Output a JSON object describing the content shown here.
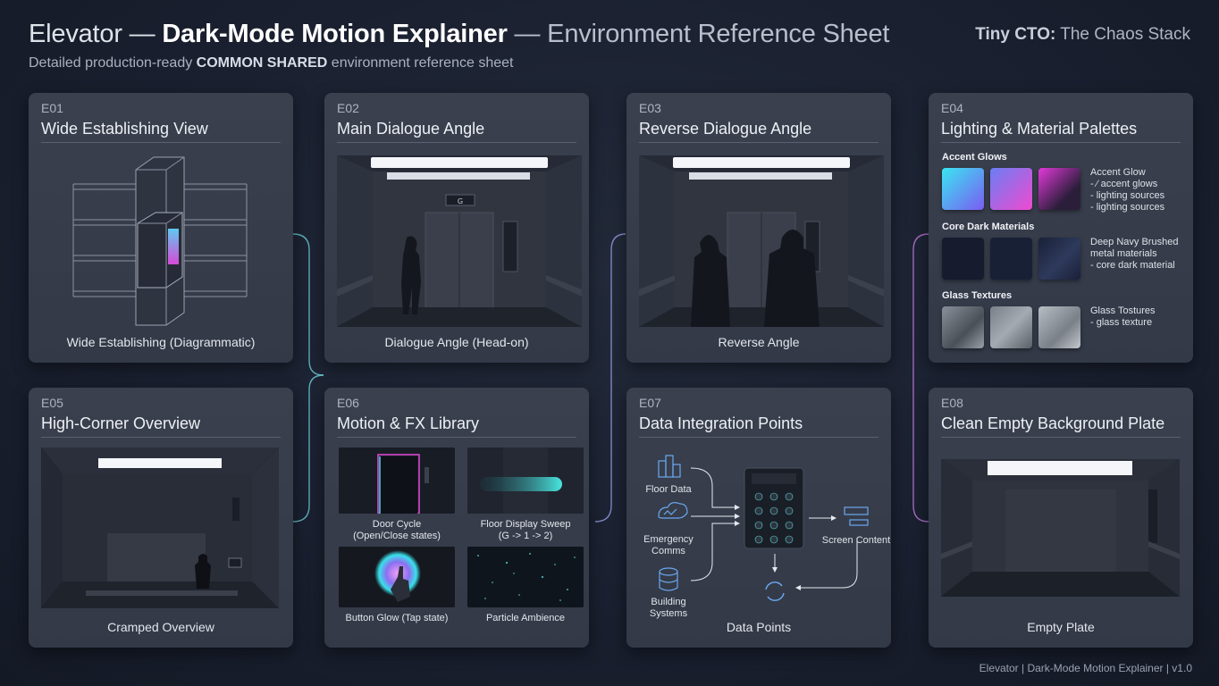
{
  "header": {
    "title_prefix": "Elevator — ",
    "title_bold": "Dark-Mode Motion Explainer",
    "title_suffix": " — Environment Reference Sheet",
    "subtitle_prefix": "Detailed production-ready ",
    "subtitle_bold": "COMMON SHARED",
    "subtitle_suffix": " environment reference sheet",
    "brand_bold": "Tiny CTO:",
    "brand_rest": " The Chaos Stack"
  },
  "footer": "Elevator | Dark-Mode Motion Explainer | v1.0",
  "panels": {
    "e01": {
      "code": "E01",
      "title": "Wide Establishing View",
      "caption": "Wide Establishing (Diagrammatic)"
    },
    "e02": {
      "code": "E02",
      "title": "Main Dialogue Angle",
      "caption": "Dialogue Angle (Head-on)",
      "floor": "G"
    },
    "e03": {
      "code": "E03",
      "title": "Reverse Dialogue Angle",
      "caption": "Reverse Angle"
    },
    "e04": {
      "code": "E04",
      "title": "Lighting & Material Palettes",
      "accent": {
        "label": "Accent Glows",
        "desc": [
          "Accent Glow",
          "- ⁄ accent glows",
          "- lighting sources",
          "- lighting sources"
        ]
      },
      "core": {
        "label": "Core Dark Materials",
        "desc": [
          "Deep Navy Brushed",
          "metal materials",
          "- core dark material"
        ]
      },
      "glass": {
        "label": "Glass Textures",
        "desc": [
          "Glass Tostures",
          "- glass texture"
        ]
      }
    },
    "e05": {
      "code": "E05",
      "title": "High-Corner Overview",
      "caption": "Cramped Overview"
    },
    "e06": {
      "code": "E06",
      "title": "Motion & FX Library",
      "items": [
        {
          "caption_1": "Door Cycle",
          "caption_2": "(Open/Close states)"
        },
        {
          "caption_1": "Floor Display Sweep",
          "caption_2": "(G -> 1 -> 2)"
        },
        {
          "caption_1": "Button Glow (Tap state)",
          "caption_2": ""
        },
        {
          "caption_1": "Particle Ambience",
          "caption_2": ""
        }
      ]
    },
    "e07": {
      "code": "E07",
      "title": "Data Integration Points",
      "caption": "Data Points",
      "floor_data": "Floor Data",
      "emergency_1": "Emergency",
      "emergency_2": "Comms",
      "building_1": "Building",
      "building_2": "Systems",
      "screen_content": "Screen Content"
    },
    "e08": {
      "code": "E08",
      "title": "Clean Empty Background Plate",
      "caption": "Empty Plate"
    }
  },
  "colors": {
    "background": "#1a2030",
    "panel": "#373d4a",
    "accent_cyan": "#3fd8ea",
    "accent_magenta": "#d04ad8",
    "connector_cyan": "#6fd0d8",
    "connector_violet": "#b57be0"
  }
}
